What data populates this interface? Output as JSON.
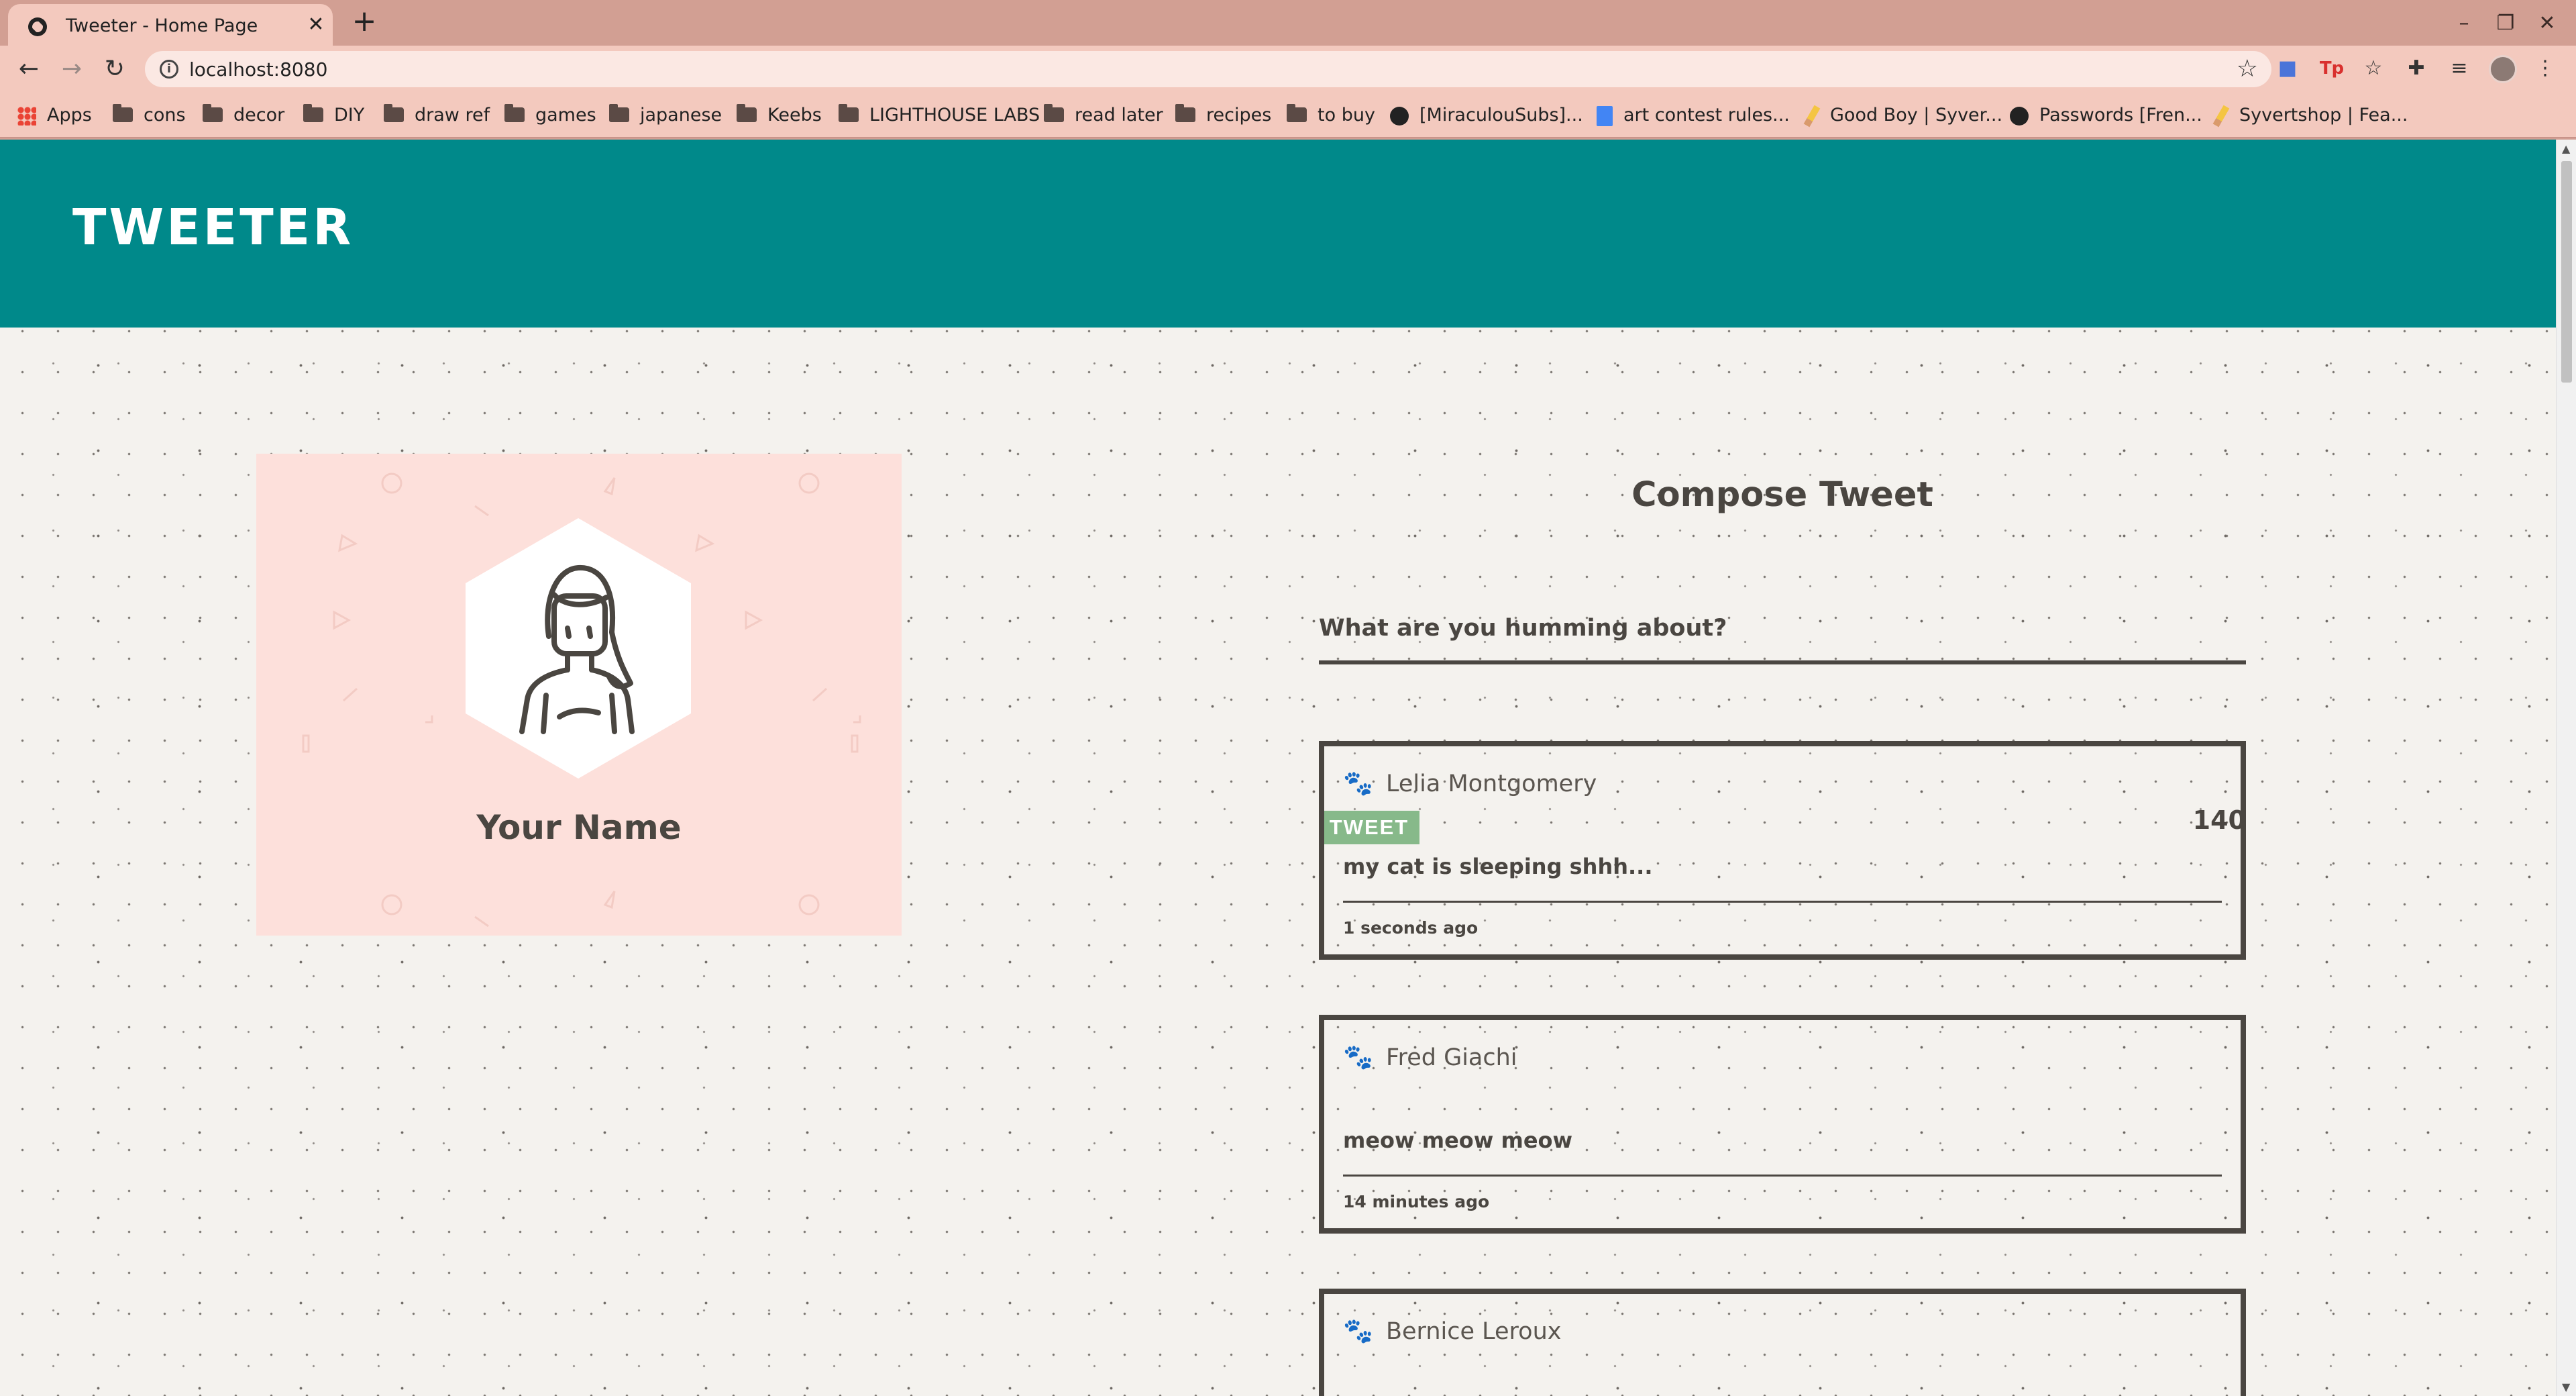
{
  "browser": {
    "tab_title": "Tweeter - Home Page",
    "url": "localhost:8080",
    "bookmarks": [
      {
        "label": "Apps",
        "icon": "apps-icon"
      },
      {
        "label": "cons",
        "icon": "folder-icon"
      },
      {
        "label": "decor",
        "icon": "folder-icon"
      },
      {
        "label": "DIY",
        "icon": "folder-icon"
      },
      {
        "label": "draw ref",
        "icon": "folder-icon"
      },
      {
        "label": "games",
        "icon": "folder-icon"
      },
      {
        "label": "japanese",
        "icon": "folder-icon"
      },
      {
        "label": "Keebs",
        "icon": "folder-icon"
      },
      {
        "label": "LIGHTHOUSE LABS",
        "icon": "folder-icon"
      },
      {
        "label": "read later",
        "icon": "folder-icon"
      },
      {
        "label": "recipes",
        "icon": "folder-icon"
      },
      {
        "label": "to buy",
        "icon": "folder-icon"
      },
      {
        "label": "[MiraculouSubs]...",
        "icon": "globe-icon"
      },
      {
        "label": "art contest rules...",
        "icon": "doc-icon"
      },
      {
        "label": "Good Boy | Syver...",
        "icon": "pencil-icon"
      },
      {
        "label": "Passwords [Fren...",
        "icon": "globe-icon"
      },
      {
        "label": "Syvertshop | Fea...",
        "icon": "pencil-icon"
      }
    ]
  },
  "nav": {
    "brand": "Tweeter"
  },
  "profile": {
    "name": "Your Name"
  },
  "compose": {
    "title": "Compose Tweet",
    "placeholder": "What are you humming about?",
    "button_label": "TWEET",
    "counter": "140"
  },
  "tweets": [
    {
      "author": "Lelia Montgomery",
      "text": "my cat is sleeping shhh...",
      "time": "1 seconds ago"
    },
    {
      "author": "Fred Giachi",
      "text": "meow meow meow",
      "time": "14 minutes ago"
    },
    {
      "author": "Bernice Leroux",
      "text": "",
      "time": ""
    }
  ],
  "colors": {
    "nav": "#00898a",
    "page_background": "#f4f2ee",
    "profile_card": "#fde0db",
    "tweet_button": "#87b98a",
    "text": "#4a4641",
    "browser_frame": "#d29f93"
  }
}
